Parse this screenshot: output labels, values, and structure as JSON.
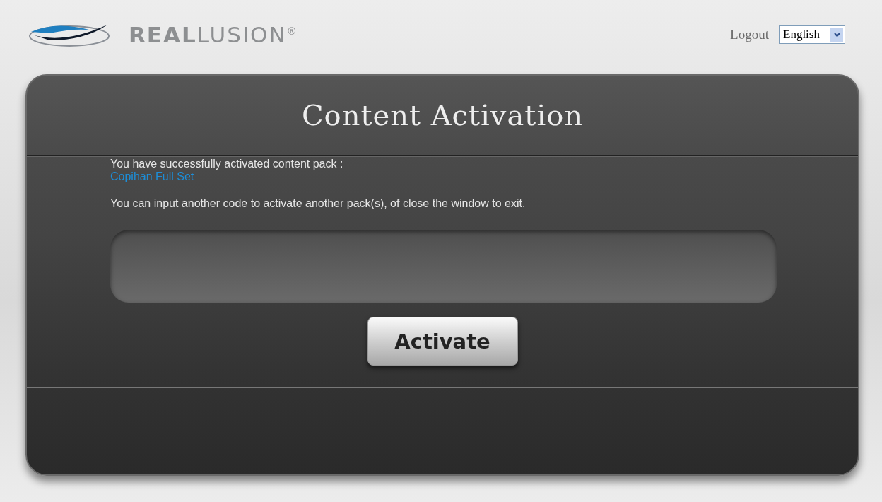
{
  "logo": {
    "text": "**REAL**LUSION$^{®}$"
  },
  "header": {
    "logout": "Logout",
    "language": "English"
  },
  "panel": {
    "title": "Content Activation",
    "success_message": "You have successfully activated content pack :",
    "pack_name": "Copihan Full Set",
    "instruction": "You can input another code to activate another pack(s), of close the window to exit.",
    "activate_button": "Activate"
  }
}
